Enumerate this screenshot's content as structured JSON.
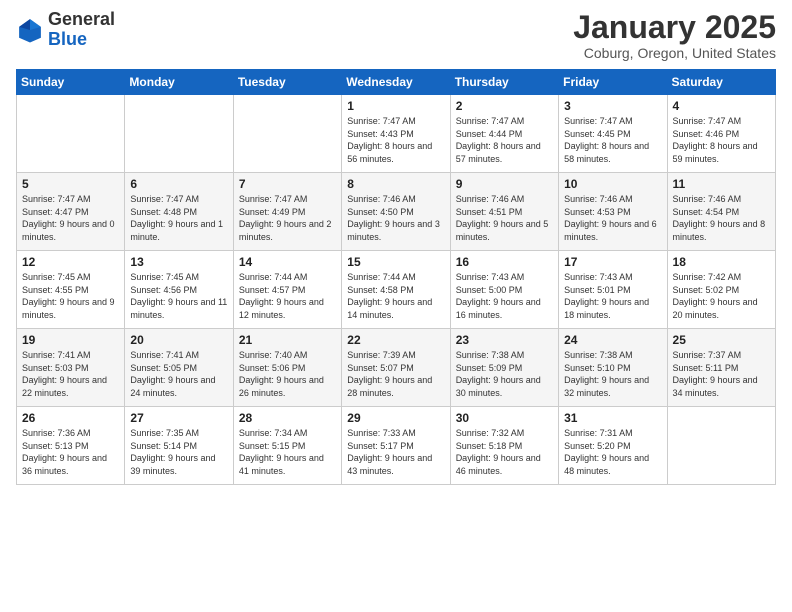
{
  "header": {
    "logo_general": "General",
    "logo_blue": "Blue",
    "month_title": "January 2025",
    "location": "Coburg, Oregon, United States"
  },
  "weekdays": [
    "Sunday",
    "Monday",
    "Tuesday",
    "Wednesday",
    "Thursday",
    "Friday",
    "Saturday"
  ],
  "weeks": [
    [
      {
        "day": "",
        "sunrise": "",
        "sunset": "",
        "daylight": ""
      },
      {
        "day": "",
        "sunrise": "",
        "sunset": "",
        "daylight": ""
      },
      {
        "day": "",
        "sunrise": "",
        "sunset": "",
        "daylight": ""
      },
      {
        "day": "1",
        "sunrise": "Sunrise: 7:47 AM",
        "sunset": "Sunset: 4:43 PM",
        "daylight": "Daylight: 8 hours and 56 minutes."
      },
      {
        "day": "2",
        "sunrise": "Sunrise: 7:47 AM",
        "sunset": "Sunset: 4:44 PM",
        "daylight": "Daylight: 8 hours and 57 minutes."
      },
      {
        "day": "3",
        "sunrise": "Sunrise: 7:47 AM",
        "sunset": "Sunset: 4:45 PM",
        "daylight": "Daylight: 8 hours and 58 minutes."
      },
      {
        "day": "4",
        "sunrise": "Sunrise: 7:47 AM",
        "sunset": "Sunset: 4:46 PM",
        "daylight": "Daylight: 8 hours and 59 minutes."
      }
    ],
    [
      {
        "day": "5",
        "sunrise": "Sunrise: 7:47 AM",
        "sunset": "Sunset: 4:47 PM",
        "daylight": "Daylight: 9 hours and 0 minutes."
      },
      {
        "day": "6",
        "sunrise": "Sunrise: 7:47 AM",
        "sunset": "Sunset: 4:48 PM",
        "daylight": "Daylight: 9 hours and 1 minute."
      },
      {
        "day": "7",
        "sunrise": "Sunrise: 7:47 AM",
        "sunset": "Sunset: 4:49 PM",
        "daylight": "Daylight: 9 hours and 2 minutes."
      },
      {
        "day": "8",
        "sunrise": "Sunrise: 7:46 AM",
        "sunset": "Sunset: 4:50 PM",
        "daylight": "Daylight: 9 hours and 3 minutes."
      },
      {
        "day": "9",
        "sunrise": "Sunrise: 7:46 AM",
        "sunset": "Sunset: 4:51 PM",
        "daylight": "Daylight: 9 hours and 5 minutes."
      },
      {
        "day": "10",
        "sunrise": "Sunrise: 7:46 AM",
        "sunset": "Sunset: 4:53 PM",
        "daylight": "Daylight: 9 hours and 6 minutes."
      },
      {
        "day": "11",
        "sunrise": "Sunrise: 7:46 AM",
        "sunset": "Sunset: 4:54 PM",
        "daylight": "Daylight: 9 hours and 8 minutes."
      }
    ],
    [
      {
        "day": "12",
        "sunrise": "Sunrise: 7:45 AM",
        "sunset": "Sunset: 4:55 PM",
        "daylight": "Daylight: 9 hours and 9 minutes."
      },
      {
        "day": "13",
        "sunrise": "Sunrise: 7:45 AM",
        "sunset": "Sunset: 4:56 PM",
        "daylight": "Daylight: 9 hours and 11 minutes."
      },
      {
        "day": "14",
        "sunrise": "Sunrise: 7:44 AM",
        "sunset": "Sunset: 4:57 PM",
        "daylight": "Daylight: 9 hours and 12 minutes."
      },
      {
        "day": "15",
        "sunrise": "Sunrise: 7:44 AM",
        "sunset": "Sunset: 4:58 PM",
        "daylight": "Daylight: 9 hours and 14 minutes."
      },
      {
        "day": "16",
        "sunrise": "Sunrise: 7:43 AM",
        "sunset": "Sunset: 5:00 PM",
        "daylight": "Daylight: 9 hours and 16 minutes."
      },
      {
        "day": "17",
        "sunrise": "Sunrise: 7:43 AM",
        "sunset": "Sunset: 5:01 PM",
        "daylight": "Daylight: 9 hours and 18 minutes."
      },
      {
        "day": "18",
        "sunrise": "Sunrise: 7:42 AM",
        "sunset": "Sunset: 5:02 PM",
        "daylight": "Daylight: 9 hours and 20 minutes."
      }
    ],
    [
      {
        "day": "19",
        "sunrise": "Sunrise: 7:41 AM",
        "sunset": "Sunset: 5:03 PM",
        "daylight": "Daylight: 9 hours and 22 minutes."
      },
      {
        "day": "20",
        "sunrise": "Sunrise: 7:41 AM",
        "sunset": "Sunset: 5:05 PM",
        "daylight": "Daylight: 9 hours and 24 minutes."
      },
      {
        "day": "21",
        "sunrise": "Sunrise: 7:40 AM",
        "sunset": "Sunset: 5:06 PM",
        "daylight": "Daylight: 9 hours and 26 minutes."
      },
      {
        "day": "22",
        "sunrise": "Sunrise: 7:39 AM",
        "sunset": "Sunset: 5:07 PM",
        "daylight": "Daylight: 9 hours and 28 minutes."
      },
      {
        "day": "23",
        "sunrise": "Sunrise: 7:38 AM",
        "sunset": "Sunset: 5:09 PM",
        "daylight": "Daylight: 9 hours and 30 minutes."
      },
      {
        "day": "24",
        "sunrise": "Sunrise: 7:38 AM",
        "sunset": "Sunset: 5:10 PM",
        "daylight": "Daylight: 9 hours and 32 minutes."
      },
      {
        "day": "25",
        "sunrise": "Sunrise: 7:37 AM",
        "sunset": "Sunset: 5:11 PM",
        "daylight": "Daylight: 9 hours and 34 minutes."
      }
    ],
    [
      {
        "day": "26",
        "sunrise": "Sunrise: 7:36 AM",
        "sunset": "Sunset: 5:13 PM",
        "daylight": "Daylight: 9 hours and 36 minutes."
      },
      {
        "day": "27",
        "sunrise": "Sunrise: 7:35 AM",
        "sunset": "Sunset: 5:14 PM",
        "daylight": "Daylight: 9 hours and 39 minutes."
      },
      {
        "day": "28",
        "sunrise": "Sunrise: 7:34 AM",
        "sunset": "Sunset: 5:15 PM",
        "daylight": "Daylight: 9 hours and 41 minutes."
      },
      {
        "day": "29",
        "sunrise": "Sunrise: 7:33 AM",
        "sunset": "Sunset: 5:17 PM",
        "daylight": "Daylight: 9 hours and 43 minutes."
      },
      {
        "day": "30",
        "sunrise": "Sunrise: 7:32 AM",
        "sunset": "Sunset: 5:18 PM",
        "daylight": "Daylight: 9 hours and 46 minutes."
      },
      {
        "day": "31",
        "sunrise": "Sunrise: 7:31 AM",
        "sunset": "Sunset: 5:20 PM",
        "daylight": "Daylight: 9 hours and 48 minutes."
      },
      {
        "day": "",
        "sunrise": "",
        "sunset": "",
        "daylight": ""
      }
    ]
  ]
}
